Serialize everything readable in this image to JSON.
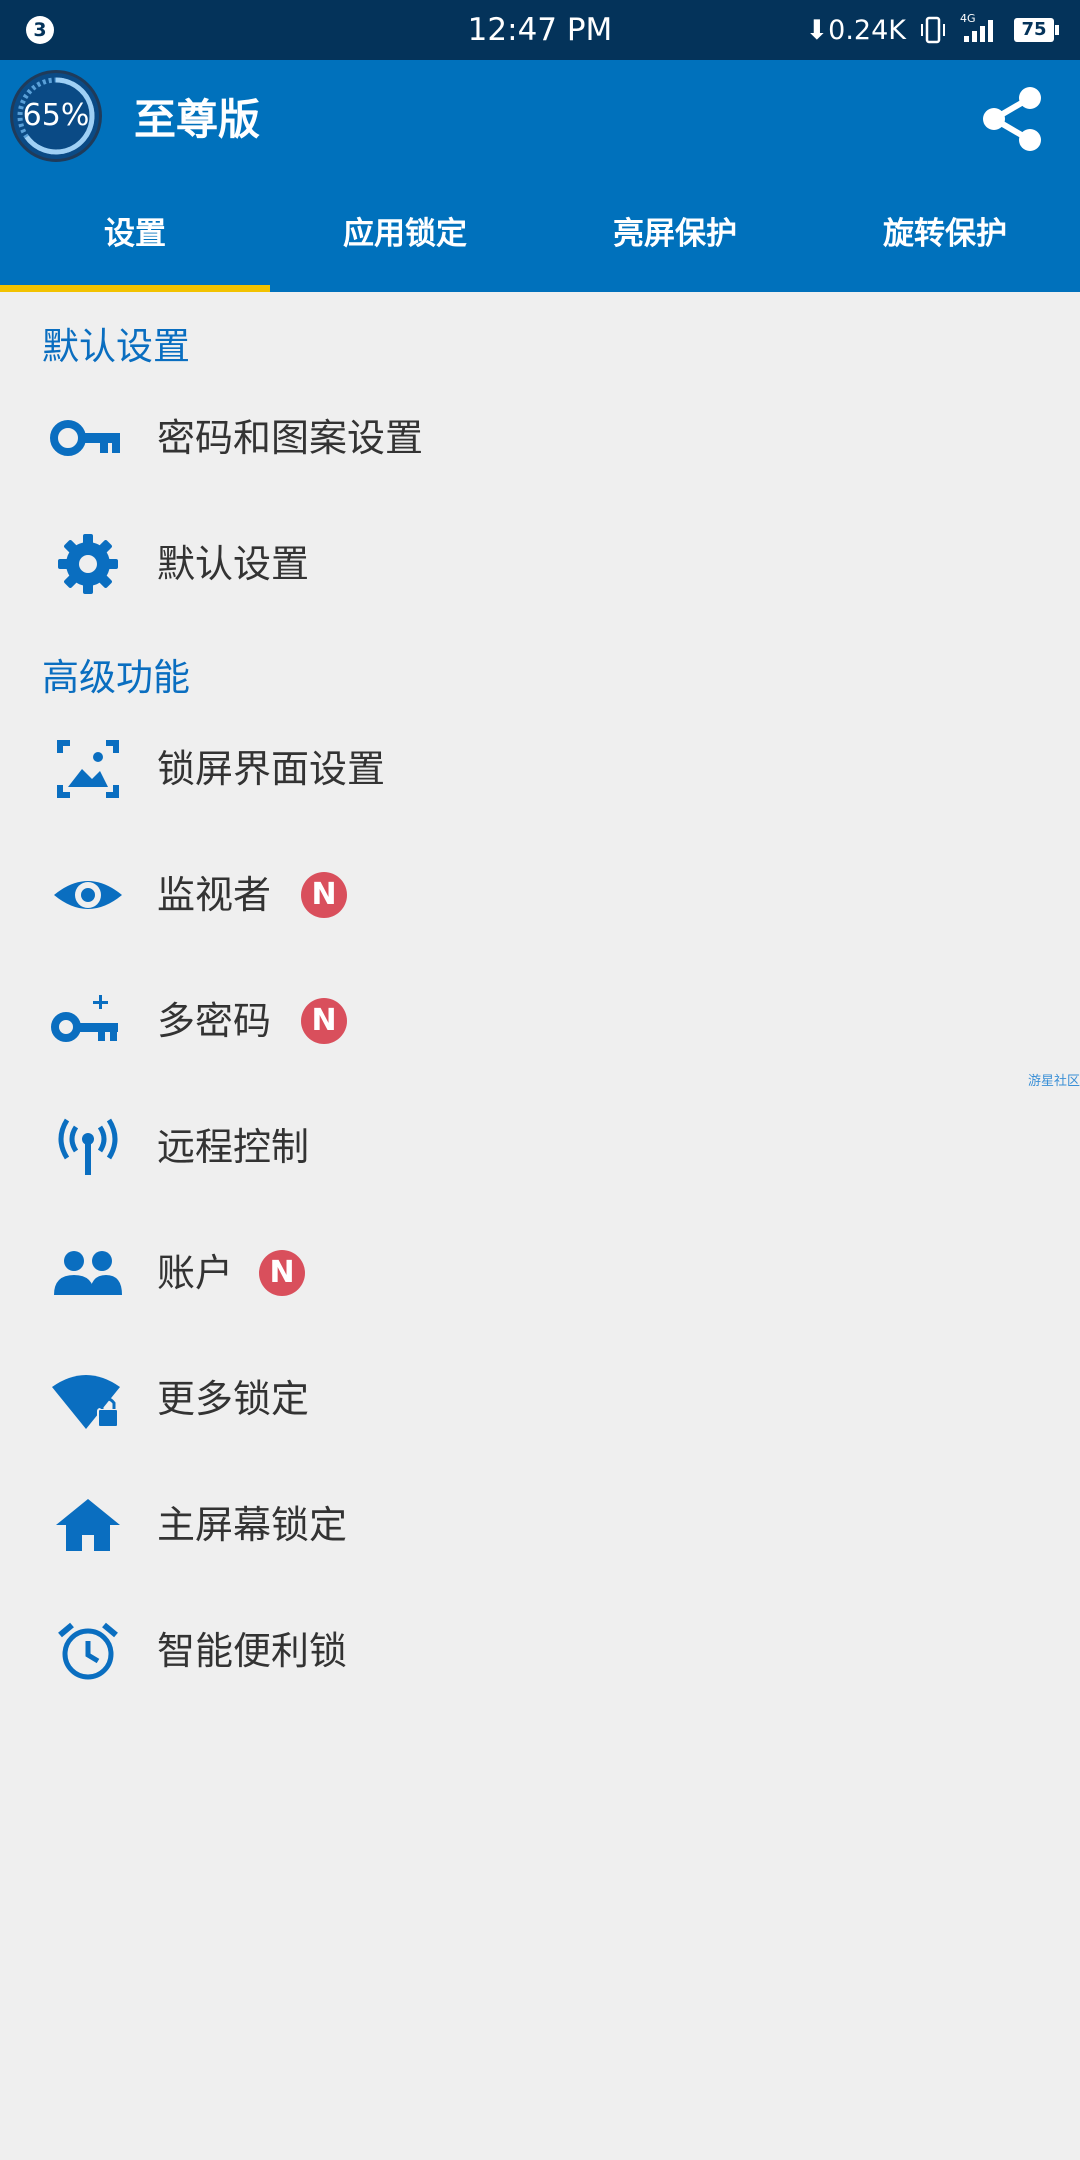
{
  "status_bar": {
    "notification_count": "3",
    "time": "12:47 PM",
    "net_speed": "⬇0.24K",
    "network": "4G",
    "battery": "75"
  },
  "app_bar": {
    "gauge_label": "65%",
    "gauge_value": 0.65,
    "title": "至尊版"
  },
  "tabs": [
    {
      "label": "设置",
      "active": true
    },
    {
      "label": "应用锁定",
      "active": false
    },
    {
      "label": "亮屏保护",
      "active": false
    },
    {
      "label": "旋转保护",
      "active": false
    }
  ],
  "sections": [
    {
      "title": "默认设置",
      "items": [
        {
          "label": "密码和图案设置",
          "icon": "key-icon",
          "badge": ""
        },
        {
          "label": "默认设置",
          "icon": "gear-icon",
          "badge": ""
        }
      ]
    },
    {
      "title": "高级功能",
      "items": [
        {
          "label": "锁屏界面设置",
          "icon": "wallpaper-icon",
          "badge": ""
        },
        {
          "label": "监视者",
          "icon": "eye-icon",
          "badge": "N"
        },
        {
          "label": "多密码",
          "icon": "key-plus-icon",
          "badge": "N"
        },
        {
          "label": "远程控制",
          "icon": "antenna-icon",
          "badge": ""
        },
        {
          "label": "账户",
          "icon": "people-icon",
          "badge": "N"
        },
        {
          "label": "更多锁定",
          "icon": "wifi-lock-icon",
          "badge": ""
        },
        {
          "label": "主屏幕锁定",
          "icon": "home-icon",
          "badge": ""
        },
        {
          "label": "智能便利锁",
          "icon": "alarm-icon",
          "badge": ""
        }
      ]
    }
  ],
  "watermark": "游星社区",
  "colors": {
    "accent": "#0071bc",
    "status_bar": "#04335a",
    "tab_indicator": "#f2c200",
    "badge": "#d94f5c",
    "section_header": "#0a6ec0"
  }
}
